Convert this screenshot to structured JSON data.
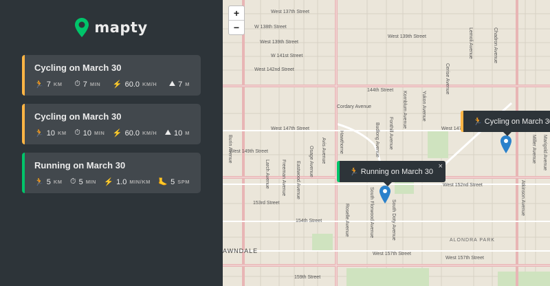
{
  "app": {
    "name": "mapty",
    "colors": {
      "brand": "#00c46a",
      "cycling": "#ffb545",
      "running": "#00c46a",
      "sidebar": "#2d3439",
      "card": "#42484d"
    }
  },
  "workouts": [
    {
      "type": "cycling",
      "title": "Cycling on March 30",
      "details": [
        {
          "icon": "cyclist-icon",
          "glyph": "🏃",
          "value": "7",
          "unit": "KM"
        },
        {
          "icon": "stopwatch-icon",
          "glyph": "⏱",
          "value": "7",
          "unit": "MIN"
        },
        {
          "icon": "lightning-icon",
          "glyph": "⚡",
          "value": "60.0",
          "unit": "KM/H"
        },
        {
          "icon": "mountain-icon",
          "glyph": "⛰",
          "value": "7",
          "unit": "M"
        }
      ]
    },
    {
      "type": "cycling",
      "title": "Cycling on March 30",
      "details": [
        {
          "icon": "cyclist-icon",
          "glyph": "🏃",
          "value": "10",
          "unit": "KM"
        },
        {
          "icon": "stopwatch-icon",
          "glyph": "⏱",
          "value": "10",
          "unit": "MIN"
        },
        {
          "icon": "lightning-icon",
          "glyph": "⚡",
          "value": "60.0",
          "unit": "KM/H"
        },
        {
          "icon": "mountain-icon",
          "glyph": "⛰",
          "value": "10",
          "unit": "M"
        }
      ]
    },
    {
      "type": "running",
      "title": "Running on March 30",
      "details": [
        {
          "icon": "runner-icon",
          "glyph": "🏃",
          "value": "5",
          "unit": "KM"
        },
        {
          "icon": "stopwatch-icon",
          "glyph": "⏱",
          "value": "5",
          "unit": "MIN"
        },
        {
          "icon": "lightning-icon",
          "glyph": "⚡",
          "value": "1.0",
          "unit": "MIN/KM"
        },
        {
          "icon": "footprint-icon",
          "glyph": "🦶",
          "value": "5",
          "unit": "SPM"
        }
      ]
    }
  ],
  "map": {
    "zoom_in": "+",
    "zoom_out": "−",
    "popups": [
      {
        "type": "cycling",
        "glyph": "🏃",
        "label": "Cycling on March 30"
      },
      {
        "type": "running",
        "glyph": "🏃",
        "label": "Running on March 30",
        "close": "×"
      }
    ],
    "labels": {
      "w137": "West 137th Street",
      "w138": "W 138th Street",
      "w139": "West 139th Street",
      "w139b": "West 139th Street",
      "w141": "W 141st Street",
      "w142": "West 142nd Street",
      "s144": "144th Street",
      "cordary": "Cordary Avenue",
      "w147": "West 147th Street",
      "w147b": "West 147th St",
      "w149": "West 149th Street",
      "w152": "West 152nd Street",
      "s153": "153rd Street",
      "s154": "154th Street",
      "w157": "West 157th Street",
      "w157b": "West 157th Street",
      "w159": "159th Street",
      "lawndale": "AWNDALE",
      "alondra": "ALONDRA PARK",
      "burin": "Burin Avenue",
      "larch": "Larch Avenue",
      "freeman": "Freeman Avenue",
      "eastwood": "Eastwood Avenue",
      "osage": "Osage Avenue",
      "avis": "Avis Avenue",
      "hawthorne": "Hawthorne",
      "kornblum": "Kornblum Avenue",
      "yukon": "Yukon Avenue",
      "cerise": "Cerise Avenue",
      "lemoli": "Lemoli Avenue",
      "chadron": "Chadron Avenue",
      "miller": "Miller Avenue",
      "marigold": "Marigold Avenue",
      "atkinson": "Atkinson Avenue",
      "doty": "South Doty Avenue",
      "florwood": "South Florwood Avenue",
      "fonthill": "Fonthill Avenue",
      "budlong": "Budlong Avenue",
      "roselle": "Roselle Avenue"
    }
  }
}
